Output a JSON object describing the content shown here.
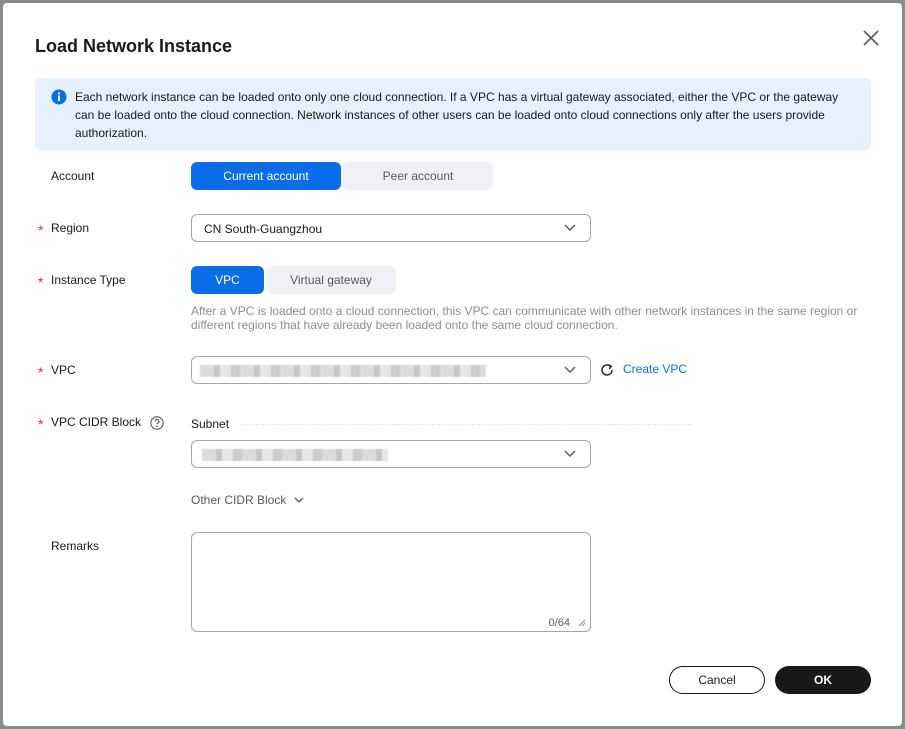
{
  "dialog": {
    "title": "Load Network Instance",
    "notice": "Each network instance can be loaded onto only one cloud connection. If a VPC has a virtual gateway associated, either the VPC or the gateway can be loaded onto the cloud connection. Network instances of other users can be loaded onto cloud connections only after the users provide authorization."
  },
  "account": {
    "label": "Account",
    "options": [
      "Current account",
      "Peer account"
    ],
    "selected": "Current account"
  },
  "region": {
    "label": "Region",
    "value": "CN South-Guangzhou"
  },
  "instance_type": {
    "label": "Instance Type",
    "options": [
      "VPC",
      "Virtual gateway"
    ],
    "selected": "VPC",
    "hint": "After a VPC is loaded onto a cloud connection, this VPC can communicate with other network instances in the same region or different regions that have already been loaded onto the same cloud connection."
  },
  "vpc": {
    "label": "VPC",
    "create_link": "Create VPC"
  },
  "cidr": {
    "label": "VPC CIDR Block",
    "subnet_label": "Subnet",
    "other_cidr": "Other CIDR Block"
  },
  "remarks": {
    "label": "Remarks",
    "counter": "0/64"
  },
  "footer": {
    "cancel": "Cancel",
    "ok": "OK"
  },
  "colors": {
    "accent": "#0b6ee8",
    "required": "#d4333f",
    "notice_bg": "#e5f1ff"
  }
}
